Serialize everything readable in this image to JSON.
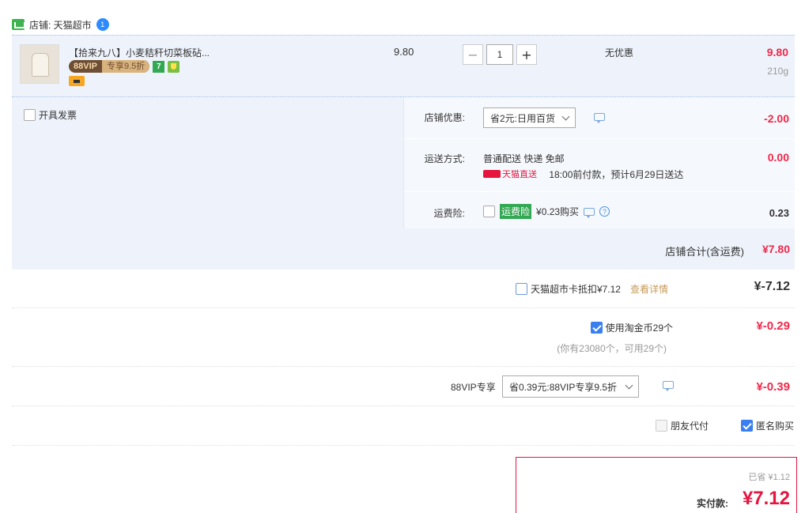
{
  "shop": {
    "label": "店铺: 天猫超市",
    "badge": "1"
  },
  "item": {
    "title": "【拾来九八】小麦秸秆切菜板砧...",
    "vip_left": "88VIP",
    "vip_right": "专享9.5折",
    "day7": "7",
    "unit_price": "9.80",
    "qty_minus": "−",
    "qty_value": "1",
    "qty_plus": "+",
    "discount": "无优惠",
    "total": "9.80",
    "weight": "210g"
  },
  "options": {
    "invoice_label": "开具发票",
    "coupon_label": "店铺优惠:",
    "coupon_select": "省2元:日用百货",
    "coupon_value": "-2.00",
    "ship_label": "运送方式:",
    "ship_method": "普通配送 快递 免邮",
    "ship_brand": "天猫直送",
    "ship_eta": "18:00前付款，预计6月29日送达",
    "ship_value": "0.00",
    "ins_label": "运费险:",
    "ins_tag": "运费险",
    "ins_price": "¥0.23购买",
    "ins_value": "0.23",
    "shop_total_label": "店铺合计(含运费)",
    "shop_total_value": "¥7.80"
  },
  "cat_card": {
    "label": "天猫超市卡抵扣¥7.12",
    "link": "查看详情",
    "value": "¥-7.12"
  },
  "coins": {
    "label": "使用淘金币29个",
    "sub": "(你有23080个，可用29个)",
    "value": "¥-0.29"
  },
  "vip": {
    "label": "88VIP专享",
    "select": "省0.39元:88VIP专享9.5折",
    "value": "¥-0.39"
  },
  "flags": {
    "friend_pay": "朋友代付",
    "anonymous": "匿名购买"
  },
  "pay": {
    "hint": "已省 ¥1.12",
    "label": "实付款:",
    "value": "¥7.12"
  },
  "colors": {
    "accent_red": "#f0284a",
    "link_blue": "#3a7ff1",
    "panel_bg": "#eef3fb"
  }
}
